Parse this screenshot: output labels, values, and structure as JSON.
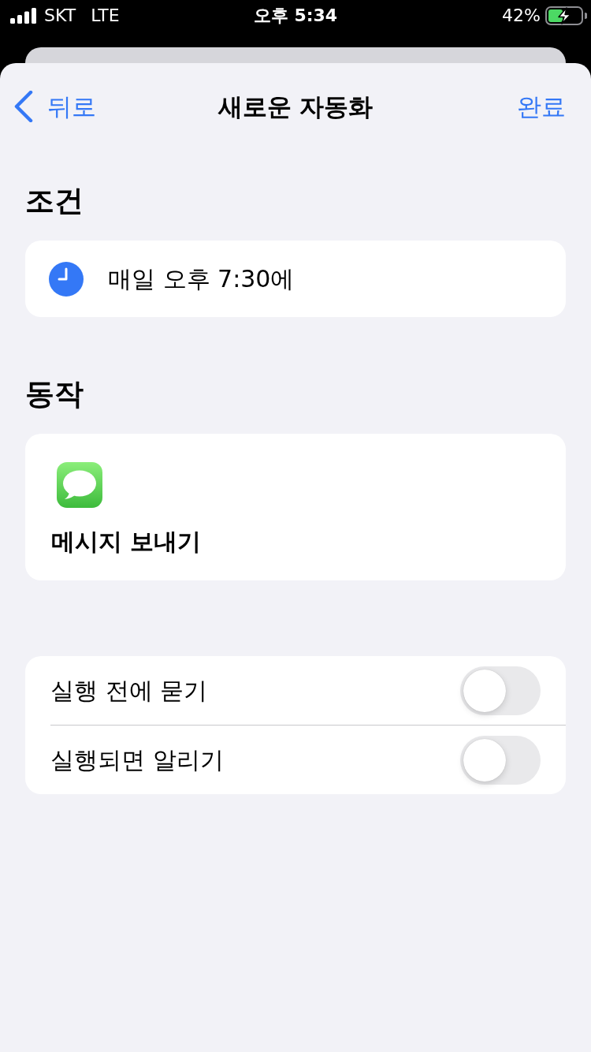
{
  "status_bar": {
    "carrier": "SKT",
    "network": "LTE",
    "time": "오후 5:34",
    "battery_percent": "42%",
    "charging": true
  },
  "nav": {
    "back": "뒤로",
    "title": "새로운 자동화",
    "done": "완료"
  },
  "condition": {
    "heading": "조건",
    "text": "매일 오후 7:30에"
  },
  "action": {
    "heading": "동작",
    "name": "메시지 보내기"
  },
  "options": [
    {
      "label": "실행 전에 묻기",
      "on": false
    },
    {
      "label": "실행되면 알리기",
      "on": false
    }
  ]
}
